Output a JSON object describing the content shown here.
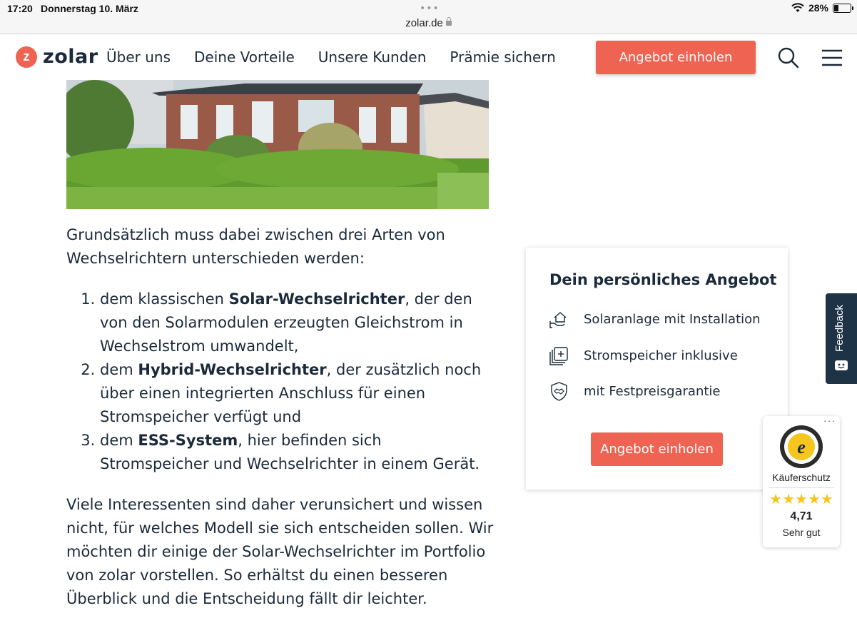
{
  "status_bar": {
    "time": "17:20",
    "date": "Donnerstag 10. März",
    "url": "zolar.de",
    "battery": "28%",
    "battery_level": 0.28
  },
  "header": {
    "logo_text": "zolar",
    "logo_mark": "z",
    "nav": [
      "Über uns",
      "Deine Vorteile",
      "Unsere Kunden",
      "Prämie sichern"
    ],
    "cta": "Angebot einholen"
  },
  "article": {
    "intro": "Grundsätzlich muss dabei zwischen drei Arten von Wechselrichtern unterschieden werden:",
    "list": [
      {
        "pre": "dem klassischen ",
        "bold": "Solar-Wechselrichter",
        "post": ", der den von den Solarmodulen erzeugten Gleichstrom in Wechselstrom umwandelt,"
      },
      {
        "pre": "dem ",
        "bold": "Hybrid-Wechselrichter",
        "post": ", der zusätzlich noch über einen integrierten Anschluss für einen Stromspeicher verfügt und"
      },
      {
        "pre": "dem ",
        "bold": "ESS-System",
        "post": ", hier befinden sich Stromspeicher und Wechselrichter in einem Gerät."
      }
    ],
    "paragraph2": "Viele Interessenten sind daher verunsichert und wissen nicht, für welches Modell sie sich entscheiden sollen. Wir möchten dir einige der Solar-Wechselrichter im Portfolio von zolar vorstellen. So erhältst du einen besseren Überblick und die Entscheidung fällt dir leichter."
  },
  "offer": {
    "title": "Dein persönliches Angebot",
    "items": [
      {
        "icon": "house-hand-icon",
        "label": "Solaranlage mit Installation"
      },
      {
        "icon": "battery-stack-icon",
        "label": "Stromspeicher inklusive"
      },
      {
        "icon": "shield-handshake-icon",
        "label": "mit Festpreisgarantie"
      }
    ],
    "cta": "Angebot einholen"
  },
  "feedback": {
    "label": "Feedback"
  },
  "trusted_shops": {
    "label": "Käuferschutz",
    "stars": "★★★★★",
    "score": "4,71",
    "rating": "Sehr gut"
  },
  "colors": {
    "accent": "#ee6352",
    "text": "#1b2a3a",
    "feedback_bg": "#1f3347",
    "star": "#f6c51e"
  }
}
